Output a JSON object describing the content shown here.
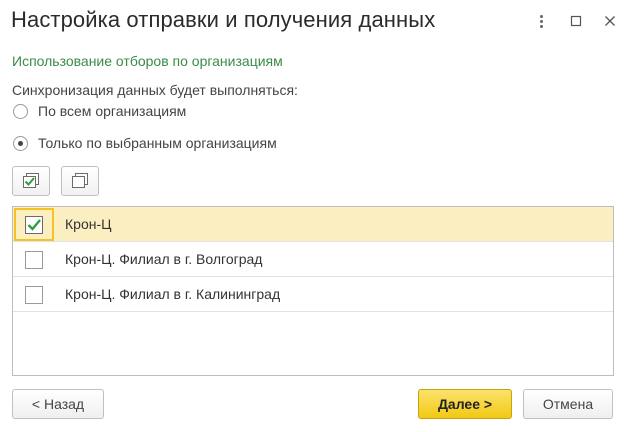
{
  "window": {
    "title": "Настройка отправки и получения данных"
  },
  "section": {
    "title": "Использование отборов по организациям"
  },
  "sync": {
    "label": "Синхронизация данных будет выполняться:",
    "options": [
      {
        "label": "По всем организациям",
        "selected": false
      },
      {
        "label": "Только по выбранным организациям",
        "selected": true
      }
    ]
  },
  "organizations": [
    {
      "name": "Крон-Ц",
      "checked": true,
      "selected": true
    },
    {
      "name": "Крон-Ц. Филиал в г. Волгоград",
      "checked": false,
      "selected": false
    },
    {
      "name": "Крон-Ц. Филиал в г. Калининград",
      "checked": false,
      "selected": false
    }
  ],
  "footer": {
    "back_label": "< Назад",
    "next_label": "Далее >",
    "cancel_label": "Отмена"
  },
  "colors": {
    "accent_green": "#3a8c47",
    "selected_row": "#fbeec0",
    "primary_button": "#f2c913",
    "focus_border": "#f3c321"
  },
  "icons": {
    "menu": "more-vertical-icon",
    "maximize": "maximize-icon",
    "close": "close-icon",
    "check_all": "check-all-icon",
    "uncheck_all": "uncheck-all-icon"
  }
}
